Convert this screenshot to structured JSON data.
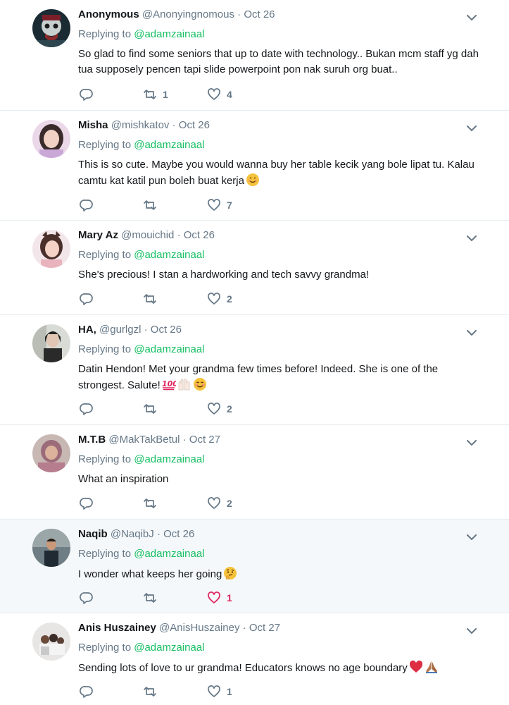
{
  "tweets": [
    {
      "name": "Anonymous",
      "handle": "@Anonyingnomous",
      "sep": "·",
      "date": "Oct 26",
      "replying_prefix": "Replying to",
      "replying_user": "@adamzainaal",
      "text": "So glad to find some seniors that up to date with technology..  Bukan mcm staff yg dah tua supposely pencen tapi slide powerpoint pon nak suruh org buat..",
      "retweets": "1",
      "likes": "4"
    },
    {
      "name": "Misha",
      "handle": "@mishkatov",
      "sep": "·",
      "date": "Oct 26",
      "replying_prefix": "Replying to",
      "replying_user": "@adamzainaal",
      "text": "This is so cute. Maybe you would wanna buy her table kecik yang bole lipat tu. Kalau camtu kat katil pun boleh buat kerja",
      "retweets": "",
      "likes": "7",
      "emojis": [
        "smiling-face-emoji"
      ]
    },
    {
      "name": "Mary Az",
      "handle": "@mouichid",
      "sep": "·",
      "date": "Oct 26",
      "replying_prefix": "Replying to",
      "replying_user": "@adamzainaal",
      "text": "She's precious! I stan a hardworking and tech savvy grandma!",
      "retweets": "",
      "likes": "2"
    },
    {
      "name": "HA,",
      "handle": "@gurlgzl",
      "sep": "·",
      "date": "Oct 26",
      "replying_prefix": "Replying to",
      "replying_user": "@adamzainaal",
      "text": "Datin Hendon! Met your grandma few times before! Indeed. She is one of the strongest. Salute!",
      "retweets": "",
      "likes": "2",
      "emojis": [
        "hundred-points-emoji",
        "raising-hands-emoji",
        "smiling-blush-emoji"
      ]
    },
    {
      "name": "M.T.B",
      "handle": "@MakTakBetul",
      "sep": "·",
      "date": "Oct 27",
      "replying_prefix": "Replying to",
      "replying_user": "@adamzainaal",
      "text": "What an inspiration",
      "retweets": "",
      "likes": "2"
    },
    {
      "name": "Naqib",
      "handle": "@NaqibJ",
      "sep": "·",
      "date": "Oct 26",
      "replying_prefix": "Replying to",
      "replying_user": "@adamzainaal",
      "text": "I wonder what keeps her going",
      "retweets": "",
      "likes": "1",
      "liked": true,
      "emojis": [
        "thinking-face-emoji"
      ]
    },
    {
      "name": "Anis Huszainey",
      "handle": "@AnisHuszainey",
      "sep": "·",
      "date": "Oct 27",
      "replying_prefix": "Replying to",
      "replying_user": "@adamzainaal",
      "text": "Sending lots of love to ur grandma! Educators knows no age boundary",
      "retweets": "",
      "likes": "1",
      "emojis": [
        "red-heart-emoji",
        "folded-hands-emoji"
      ]
    }
  ],
  "colors": {
    "accent": "#17bf63",
    "muted": "#657786",
    "liked": "#e0245e",
    "highlight_bg": "#f5f8fa"
  },
  "icons": {
    "reply": "reply-icon",
    "retweet": "retweet-icon",
    "like": "heart-icon",
    "menu": "chevron-down-icon"
  }
}
